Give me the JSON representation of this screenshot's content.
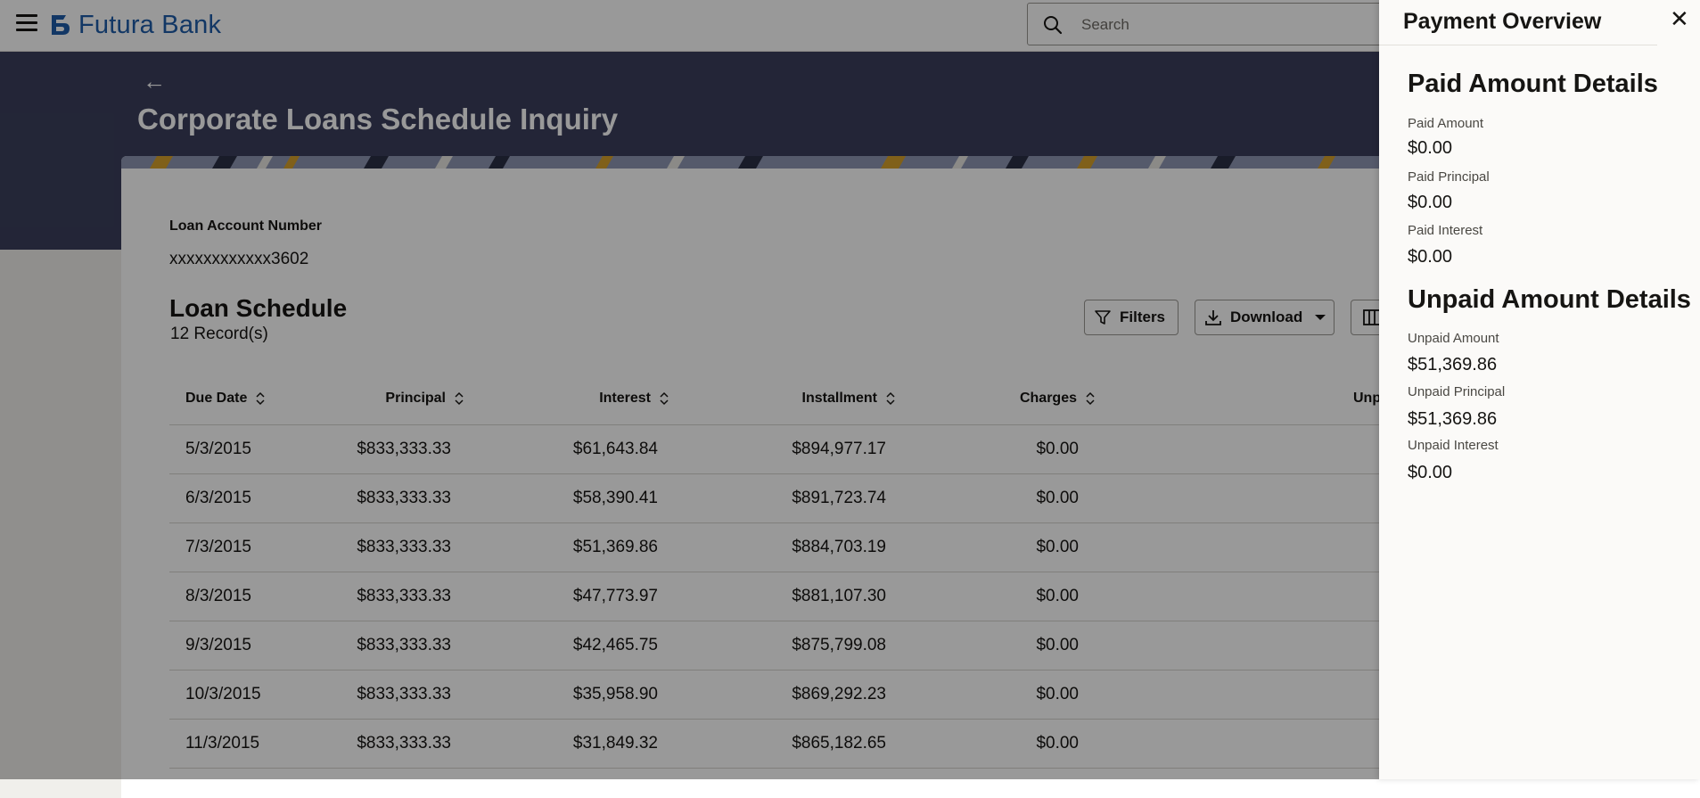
{
  "header": {
    "brand": "Futura Bank",
    "search_placeholder": "Search",
    "brand_color": "#1e5da8"
  },
  "page": {
    "title": "Corporate Loans Schedule Inquiry",
    "loan_account_label": "Loan Account Number",
    "loan_account_value": "xxxxxxxxxxxx3602",
    "schedule_title": "Loan Schedule",
    "record_count": "12 Record(s)",
    "filters_label": "Filters",
    "download_label": "Download"
  },
  "table": {
    "headers": {
      "due_date": "Due Date",
      "principal": "Principal",
      "interest": "Interest",
      "installment": "Installment",
      "charges": "Charges",
      "unpaid": "Unpa"
    },
    "rows": [
      {
        "due_date": "5/3/2015",
        "principal": "$833,333.33",
        "interest": "$61,643.84",
        "installment": "$894,977.17",
        "charges": "$0.00"
      },
      {
        "due_date": "6/3/2015",
        "principal": "$833,333.33",
        "interest": "$58,390.41",
        "installment": "$891,723.74",
        "charges": "$0.00"
      },
      {
        "due_date": "7/3/2015",
        "principal": "$833,333.33",
        "interest": "$51,369.86",
        "installment": "$884,703.19",
        "charges": "$0.00"
      },
      {
        "due_date": "8/3/2015",
        "principal": "$833,333.33",
        "interest": "$47,773.97",
        "installment": "$881,107.30",
        "charges": "$0.00"
      },
      {
        "due_date": "9/3/2015",
        "principal": "$833,333.33",
        "interest": "$42,465.75",
        "installment": "$875,799.08",
        "charges": "$0.00"
      },
      {
        "due_date": "10/3/2015",
        "principal": "$833,333.33",
        "interest": "$35,958.90",
        "installment": "$869,292.23",
        "charges": "$0.00"
      },
      {
        "due_date": "11/3/2015",
        "principal": "$833,333.33",
        "interest": "$31,849.32",
        "installment": "$865,182.65",
        "charges": "$0.00"
      }
    ]
  },
  "panel": {
    "title": "Payment Overview",
    "paid_title": "Paid Amount Details",
    "paid_amount_label": "Paid Amount",
    "paid_amount": "$0.00",
    "paid_principal_label": "Paid Principal",
    "paid_principal": "$0.00",
    "paid_interest_label": "Paid Interest",
    "paid_interest": "$0.00",
    "unpaid_title": "Unpaid Amount Details",
    "unpaid_amount_label": "Unpaid Amount",
    "unpaid_amount": "$51,369.86",
    "unpaid_principal_label": "Unpaid Principal",
    "unpaid_principal": "$51,369.86",
    "unpaid_interest_label": "Unpaid Interest",
    "unpaid_interest": "$0.00"
  }
}
